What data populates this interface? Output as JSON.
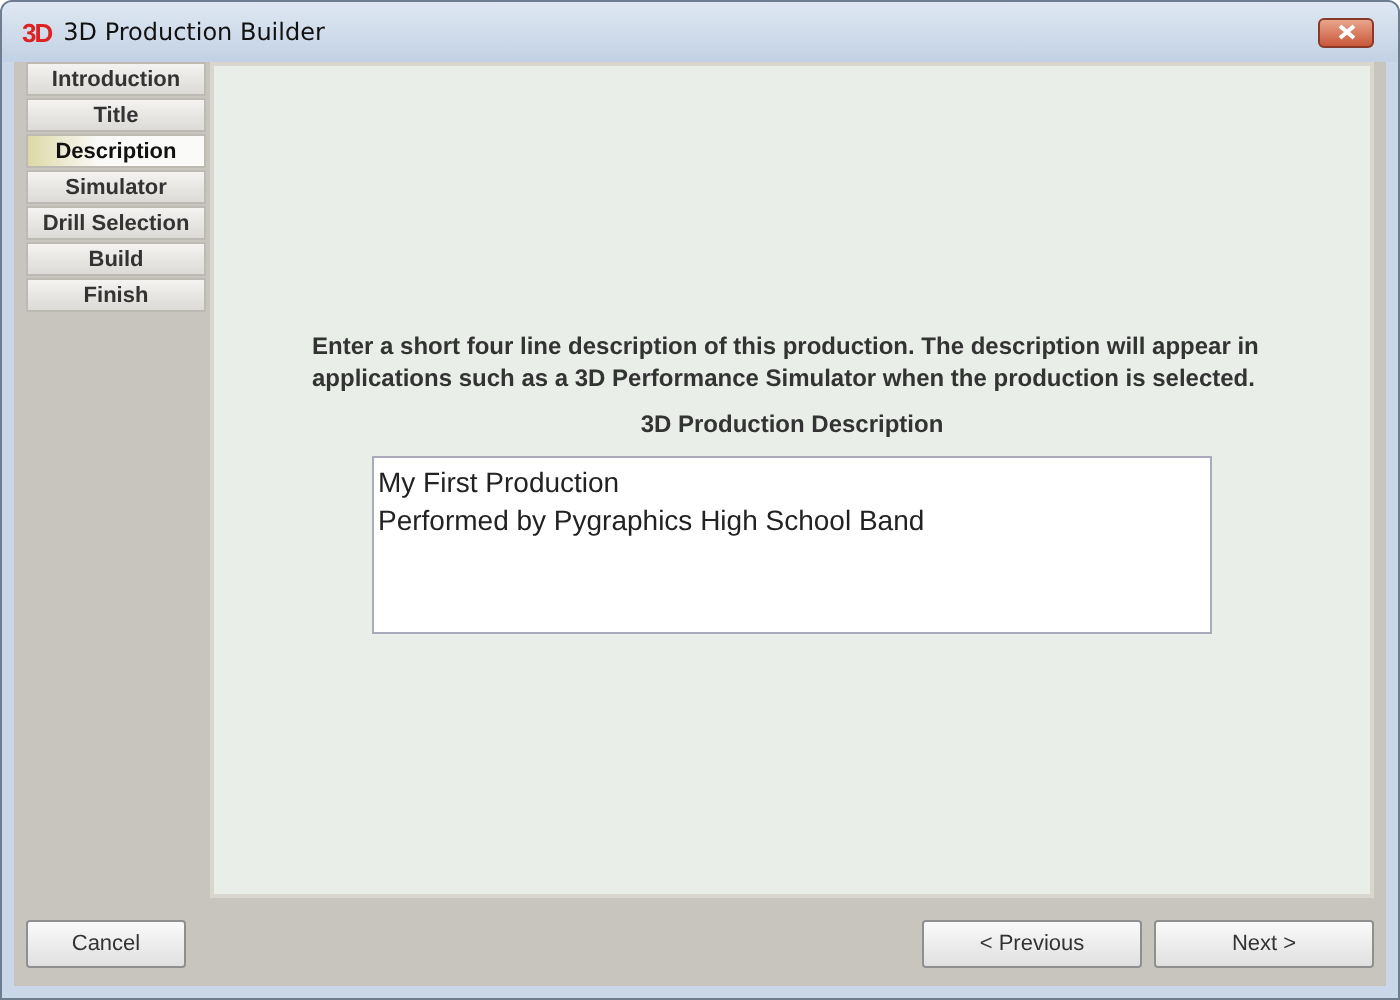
{
  "window": {
    "logo": "3D",
    "title": "3D Production Builder"
  },
  "steps": [
    {
      "label": "Introduction",
      "selected": false
    },
    {
      "label": "Title",
      "selected": false
    },
    {
      "label": "Description",
      "selected": true
    },
    {
      "label": "Simulator",
      "selected": false
    },
    {
      "label": "Drill Selection",
      "selected": false
    },
    {
      "label": "Build",
      "selected": false
    },
    {
      "label": "Finish",
      "selected": false
    }
  ],
  "instructions": "Enter a short four line description of this production.  The description will appear in applications such as a 3D Performance Simulator when the production is selected.",
  "description_label": "3D Production Description",
  "description_lines": [
    "My First Production",
    "Performed by Pygraphics High School Band"
  ],
  "buttons": {
    "cancel": "Cancel",
    "previous": "< Previous",
    "next": "Next >"
  }
}
